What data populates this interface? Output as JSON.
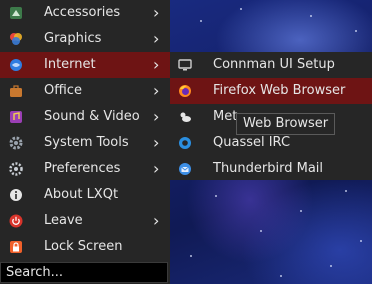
{
  "menu": {
    "items": [
      {
        "label": "Accessories",
        "icon": "accessories-icon",
        "has_submenu": true
      },
      {
        "label": "Graphics",
        "icon": "graphics-icon",
        "has_submenu": true
      },
      {
        "label": "Internet",
        "icon": "internet-icon",
        "has_submenu": true,
        "active": true
      },
      {
        "label": "Office",
        "icon": "office-icon",
        "has_submenu": true
      },
      {
        "label": "Sound & Video",
        "icon": "sound-video-icon",
        "has_submenu": true
      },
      {
        "label": "System Tools",
        "icon": "system-tools-icon",
        "has_submenu": true
      },
      {
        "label": "Preferences",
        "icon": "preferences-icon",
        "has_submenu": true
      },
      {
        "label": "About LXQt",
        "icon": "info-icon",
        "has_submenu": false
      },
      {
        "label": "Leave",
        "icon": "power-icon",
        "has_submenu": true
      },
      {
        "label": "Lock Screen",
        "icon": "lock-icon",
        "has_submenu": false
      }
    ],
    "arrow": "›"
  },
  "search": {
    "placeholder": "Search..."
  },
  "submenu": {
    "items": [
      {
        "label": "Connman UI Setup",
        "icon": "monitor-icon"
      },
      {
        "label": "Firefox Web Browser",
        "icon": "firefox-icon",
        "active": true
      },
      {
        "label": "Met",
        "icon": "weather-icon"
      },
      {
        "label": "Quassel IRC",
        "icon": "quassel-icon"
      },
      {
        "label": "Thunderbird Mail",
        "icon": "thunderbird-icon"
      }
    ]
  },
  "tooltip": {
    "text": "Web Browser"
  },
  "colors": {
    "menu_bg": "#262626",
    "highlight": "#6e1414",
    "text": "#e6e6e6"
  }
}
